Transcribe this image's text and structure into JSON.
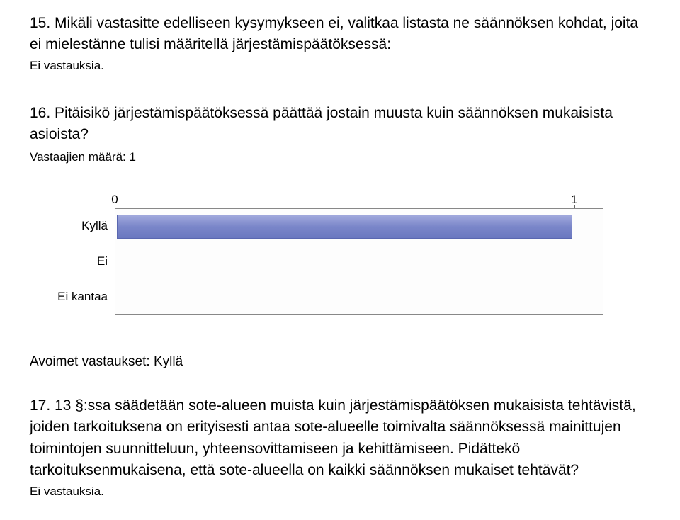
{
  "q15": {
    "title": "15. Mikäli vastasitte edelliseen kysymykseen ei, valitkaa listasta ne säännöksen kohdat, joita ei mielestänne tulisi määritellä järjestämispäätöksessä:",
    "no_answer": "Ei vastauksia."
  },
  "q16": {
    "title": "16. Pitäisikö järjestämispäätöksessä päättää jostain muusta kuin säännöksen mukaisista asioista?",
    "respondent_count": "Vastaajien määrä: 1"
  },
  "chart_data": {
    "type": "bar",
    "orientation": "horizontal",
    "categories": [
      "Kyllä",
      "Ei",
      "Ei kantaa"
    ],
    "values": [
      1,
      0,
      0
    ],
    "xlim": [
      0,
      1
    ],
    "xticks": [
      0,
      1
    ],
    "xtick_labels": [
      "0",
      "1"
    ]
  },
  "open_answers": {
    "label": "Avoimet vastaukset: Kyllä"
  },
  "q17": {
    "title": "17. 13 §:ssa säädetään sote-alueen muista kuin järjestämispäätöksen mukaisista tehtävistä, joiden tarkoituksena on erityisesti antaa sote-alueelle toimivalta säännöksessä mainittujen toimintojen suunnitteluun, yhteensovittamiseen ja kehittämiseen. Pidättekö tarkoituksenmukaisena, että sote-alueella on kaikki säännöksen mukaiset tehtävät?",
    "no_answer": "Ei vastauksia."
  }
}
